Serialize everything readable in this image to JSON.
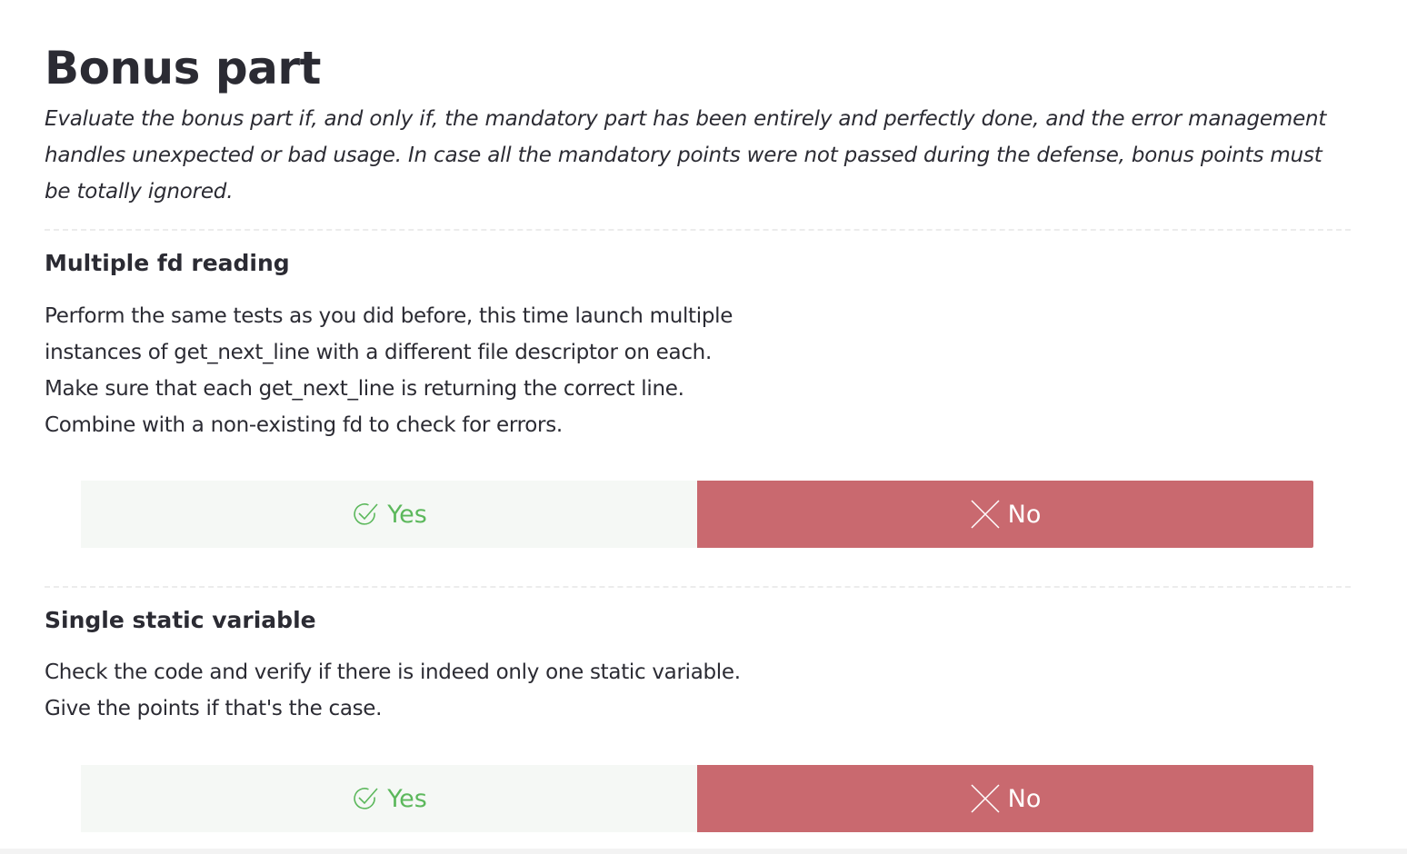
{
  "section": {
    "title": "Bonus part",
    "description": "Evaluate the bonus part if, and only if, the mandatory part has been entirely and perfectly done, and the error management handles unexpected or bad usage. In case all the mandatory points were not passed during the defense, bonus points must be totally ignored."
  },
  "items": [
    {
      "title": "Multiple fd reading",
      "description": "Perform the same tests as you did before, this time launch multiple instances of get_next_line with a different file descriptor on each. Make sure that each get_next_line is returning the correct line. Combine with a non-existing fd to check for errors.",
      "yes_label": "Yes",
      "no_label": "No",
      "selected": "No"
    },
    {
      "title": "Single static variable",
      "description": "Check the code and verify if there is indeed only one static variable. Give the points if that's the case.",
      "yes_label": "Yes",
      "no_label": "No",
      "selected": "No"
    }
  ],
  "icons": {
    "yes": "check-circle-icon",
    "no": "close-x-icon"
  },
  "colors": {
    "yes_text": "#5cb85c",
    "yes_bg": "#f5f8f5",
    "no_bg": "#c9696f",
    "no_text": "#ffffff",
    "text": "#2b2b33"
  }
}
